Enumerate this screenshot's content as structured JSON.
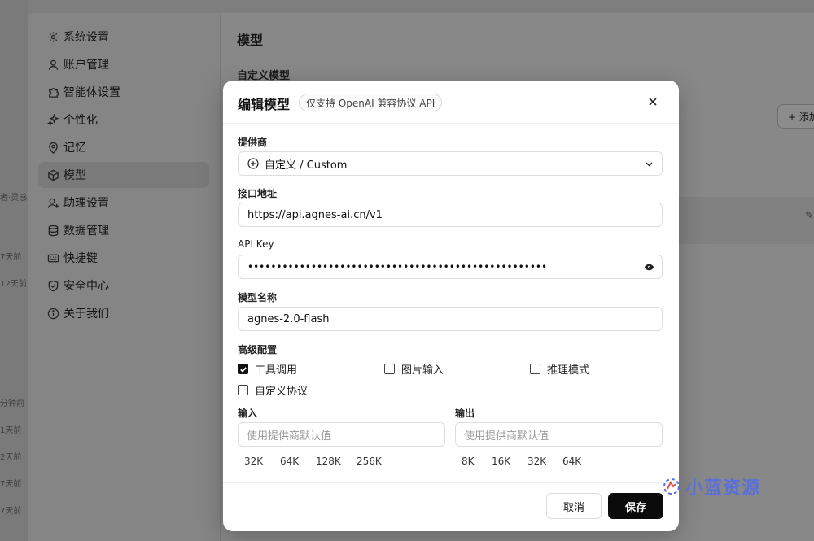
{
  "background_window": {
    "left_edge_labels": [
      "者·灵感",
      "7天前",
      "12天前",
      "分钟前",
      "1天前",
      "2天前",
      "7天前",
      "7天前"
    ],
    "sidebar": {
      "items": [
        {
          "label": "系统设置",
          "icon": "gear-icon"
        },
        {
          "label": "账户管理",
          "icon": "user-icon"
        },
        {
          "label": "智能体设置",
          "icon": "puzzle-icon"
        },
        {
          "label": "个性化",
          "icon": "sparkle-icon"
        },
        {
          "label": "记忆",
          "icon": "pin-icon"
        },
        {
          "label": "模型",
          "icon": "cube-icon",
          "active": true
        },
        {
          "label": "助理设置",
          "icon": "assistant-icon"
        },
        {
          "label": "数据管理",
          "icon": "database-icon"
        },
        {
          "label": "快捷键",
          "icon": "keyboard-icon"
        },
        {
          "label": "安全中心",
          "icon": "shield-icon"
        },
        {
          "label": "关于我们",
          "icon": "info-icon"
        }
      ]
    },
    "main": {
      "title": "模型",
      "subtitle": "自定义模型",
      "add_button": "+ 添加"
    }
  },
  "modal": {
    "title": "编辑模型",
    "badge": "仅支持 OpenAI 兼容协议 API",
    "provider": {
      "label": "提供商",
      "value": "自定义 / Custom"
    },
    "endpoint": {
      "label": "接口地址",
      "value": "https://api.agnes-ai.cn/v1"
    },
    "api_key": {
      "label": "API Key",
      "value": "••••••••••••••••••••••••••••••••••••••••••••••••••••"
    },
    "model_name": {
      "label": "模型名称",
      "value": "agnes-2.0-flash"
    },
    "advanced": {
      "label": "高级配置",
      "options": [
        {
          "label": "工具调用",
          "checked": true
        },
        {
          "label": "图片输入",
          "checked": false
        },
        {
          "label": "推理模式",
          "checked": false
        },
        {
          "label": "自定义协议",
          "checked": false
        }
      ]
    },
    "input_tokens": {
      "label": "输入",
      "placeholder": "使用提供商默认值",
      "presets": [
        "32K",
        "64K",
        "128K",
        "256K"
      ]
    },
    "output_tokens": {
      "label": "输出",
      "placeholder": "使用提供商默认值",
      "presets": [
        "8K",
        "16K",
        "32K",
        "64K"
      ]
    },
    "cancel_label": "取消",
    "save_label": "保存"
  },
  "watermark": {
    "text": "小蓝资源"
  },
  "colors": {
    "accent": "#0b0b0b",
    "watermark": "#5a6fd8"
  }
}
